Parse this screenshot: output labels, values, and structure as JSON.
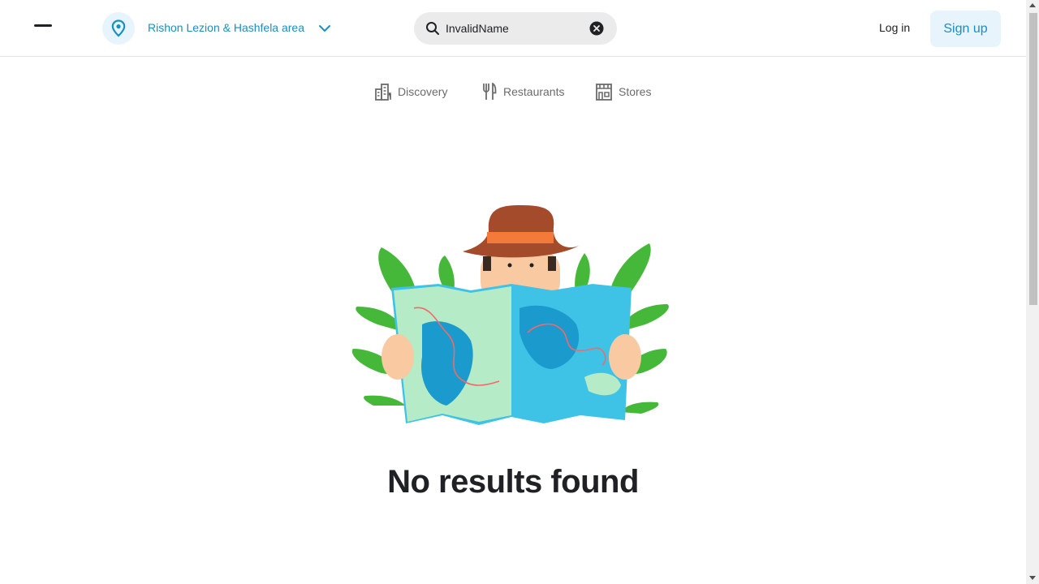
{
  "header": {
    "location": {
      "label": "Rishon Lezion & Hashfela area"
    },
    "search": {
      "value": "InvalidName"
    },
    "login_label": "Log in",
    "signup_label": "Sign up"
  },
  "tabs": [
    {
      "label": "Discovery",
      "icon": "discovery-icon"
    },
    {
      "label": "Restaurants",
      "icon": "fork-knife-icon"
    },
    {
      "label": "Stores",
      "icon": "store-icon"
    }
  ],
  "main": {
    "message": "No results found"
  },
  "colors": {
    "accent": "#1a8ec4",
    "accent_bg": "#e7f4fb",
    "text": "#202125",
    "muted": "#6b6b6b"
  }
}
